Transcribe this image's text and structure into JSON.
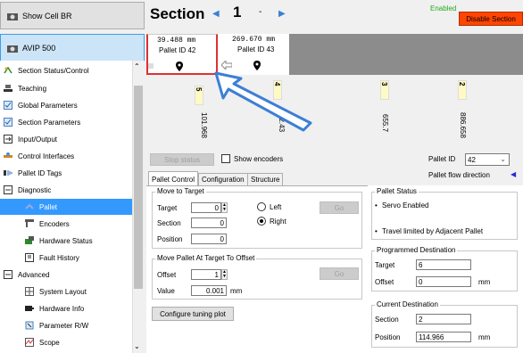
{
  "left": {
    "show_cell_br": "Show Cell BR",
    "avip": "AVIP 500",
    "tree": [
      {
        "label": "Section Status/Control",
        "icon": "section-status-icon"
      },
      {
        "label": "Teaching",
        "icon": "teaching-icon"
      },
      {
        "label": "Global Parameters",
        "icon": "checkbox-icon"
      },
      {
        "label": "Section Parameters",
        "icon": "checkbox-icon"
      },
      {
        "label": "Input/Output",
        "icon": "io-icon"
      },
      {
        "label": "Control Interfaces",
        "icon": "control-icon"
      },
      {
        "label": "Pallet ID Tags",
        "icon": "tag-icon"
      },
      {
        "label": "Diagnostic",
        "icon": "collapse-icon"
      },
      {
        "label": "Pallet",
        "icon": "pallet-icon"
      },
      {
        "label": "Encoders",
        "icon": "encoder-icon"
      },
      {
        "label": "Hardware Status",
        "icon": "hardware-icon"
      },
      {
        "label": "Fault History",
        "icon": "history-icon"
      },
      {
        "label": "Advanced",
        "icon": "collapse-icon"
      },
      {
        "label": "System Layout",
        "icon": "layout-icon"
      },
      {
        "label": "Hardware Info",
        "icon": "info-icon"
      },
      {
        "label": "Parameter R/W",
        "icon": "param-icon"
      },
      {
        "label": "Scope",
        "icon": "scope-icon"
      }
    ]
  },
  "header": {
    "title": "Section",
    "section_number": "1",
    "enabled": "Enabled",
    "disable_btn": "Disable Section"
  },
  "track": {
    "pallet1": {
      "pos": "39.488 mm",
      "id": "Pallet ID 42"
    },
    "pallet2": {
      "pos": "269.670 mm",
      "id": "Pallet ID 43"
    },
    "markers": [
      {
        "top": "5",
        "bottom": "101.968"
      },
      {
        "top": "4",
        "bottom": "32.43"
      },
      {
        "top": "3",
        "bottom": "655.7"
      },
      {
        "top": "2",
        "bottom": "886.658"
      }
    ]
  },
  "controls": {
    "stop_status": "Stop status",
    "show_encoders": "Show encoders",
    "pallet_id_label": "Pallet ID",
    "pallet_id_value": "42",
    "pallet_flow": "Pallet flow direction"
  },
  "tabs": [
    "Pallet Control",
    "Configuration",
    "Structure"
  ],
  "move_to_target": {
    "title": "Move to Target",
    "target_label": "Target",
    "target_value": "0",
    "section_label": "Section",
    "section_value": "0",
    "position_label": "Position",
    "position_value": "0",
    "left": "Left",
    "right": "Right",
    "go": "Go"
  },
  "move_offset": {
    "title": "Move Pallet At Target To Offset",
    "offset_label": "Offset",
    "offset_value": "1",
    "value_label": "Value",
    "value_value": "0.001",
    "unit": "mm",
    "go": "Go"
  },
  "tuning": "Configure tuning plot",
  "pallet_status": {
    "title": "Pallet Status",
    "line1": "Servo Enabled",
    "line2": "Travel limited by Adjacent Pallet"
  },
  "programmed": {
    "title": "Programmed Destination",
    "target_label": "Target",
    "target_value": "6",
    "offset_label": "Offset",
    "offset_value": "0",
    "unit": "mm"
  },
  "current": {
    "title": "Current Destination",
    "section_label": "Section",
    "section_value": "2",
    "position_label": "Position",
    "position_value": "114.966",
    "unit": "mm"
  }
}
